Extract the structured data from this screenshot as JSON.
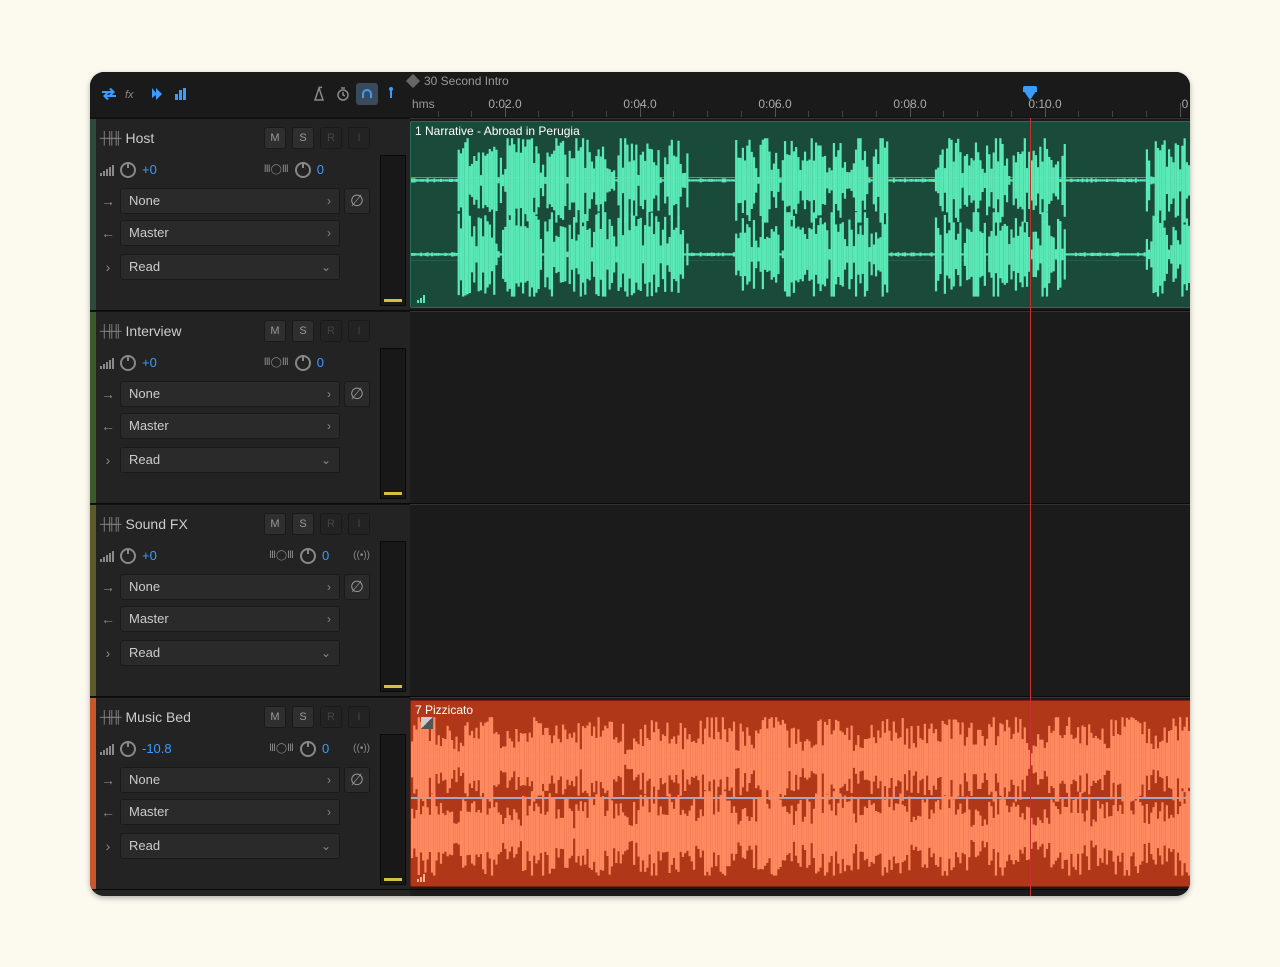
{
  "session": {
    "title": "30 Second Intro"
  },
  "ruler": {
    "unit": "hms",
    "ticks": [
      "0:02.0",
      "0:04.0",
      "0:06.0",
      "0:08.0",
      "0:10.0"
    ],
    "playhead_time": "0:09.7"
  },
  "tracks": [
    {
      "name": "Host",
      "volume": "+0",
      "pan": "0",
      "send": "None",
      "output": "Master",
      "automation": "Read",
      "mute": "M",
      "solo": "S",
      "record": "R",
      "input": "I",
      "has_stereo_send": false,
      "clip": {
        "label": "1 Narrative - Abroad in Perugia"
      }
    },
    {
      "name": "Interview",
      "volume": "+0",
      "pan": "0",
      "send": "None",
      "output": "Master",
      "automation": "Read",
      "mute": "M",
      "solo": "S",
      "record": "R",
      "input": "I",
      "has_stereo_send": false,
      "clip": null
    },
    {
      "name": "Sound FX",
      "volume": "+0",
      "pan": "0",
      "send": "None",
      "output": "Master",
      "automation": "Read",
      "mute": "M",
      "solo": "S",
      "record": "R",
      "input": "I",
      "has_stereo_send": true,
      "clip": null
    },
    {
      "name": "Music Bed",
      "volume": "-10.8",
      "pan": "0",
      "send": "None",
      "output": "Master",
      "automation": "Read",
      "mute": "M",
      "solo": "S",
      "record": "R",
      "input": "I",
      "has_stereo_send": true,
      "clip": {
        "label": "7 Pizzicato"
      }
    }
  ]
}
